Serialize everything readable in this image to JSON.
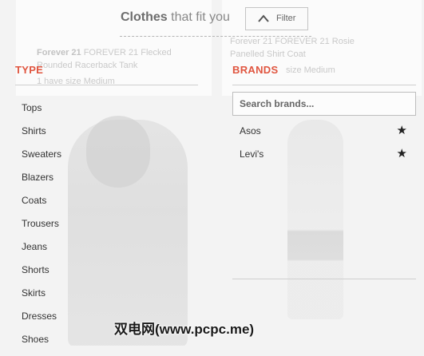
{
  "header": {
    "title_strong": "Clothes",
    "title_rest": " that fit you",
    "filter_label": "Filter"
  },
  "background": {
    "left_card_line1_brand": "Forever 21",
    "left_card_line1_rest": " FOREVER 21 Flecked",
    "left_card_line2": "Rounded Racerback Tank",
    "left_card_line3": "1 have size Medium",
    "right_card_line1": "Forever 21 FOREVER 21 Rosie",
    "right_card_line2": "Panelled Shirt Coat",
    "right_card_line3": "size Medium"
  },
  "type_section": {
    "title": "TYPE",
    "items": [
      "Tops",
      "Shirts",
      "Sweaters",
      "Blazers",
      "Coats",
      "Trousers",
      "Jeans",
      "Shorts",
      "Skirts",
      "Dresses",
      "Shoes"
    ]
  },
  "brands_section": {
    "title": "BRANDS",
    "search_placeholder": "Search brands...",
    "items": [
      {
        "name": "Asos",
        "icon": "star-icon"
      },
      {
        "name": "Levi's",
        "icon": "star-icon"
      }
    ]
  },
  "watermark": "双电网(www.pcpc.me)",
  "colors": {
    "accent": "#e0553f",
    "text": "#333333",
    "background": "#f3f3f3"
  }
}
